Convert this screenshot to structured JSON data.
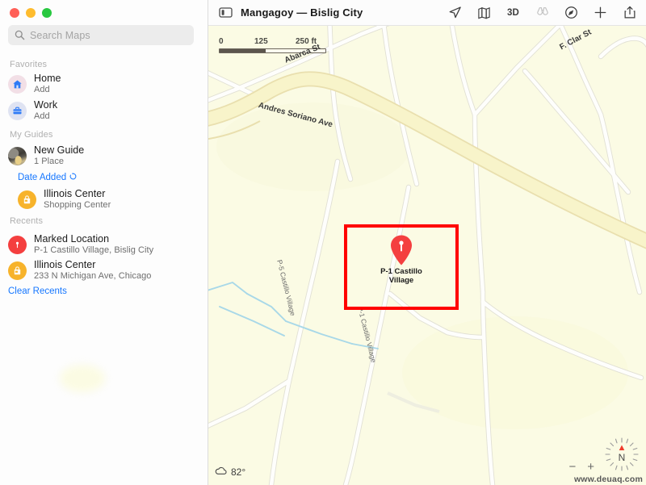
{
  "window": {
    "title": "Mangagoy — Bislig City",
    "traffic_lights": {
      "close": "close-window",
      "minimize": "minimize-window",
      "maximize": "maximize-window"
    }
  },
  "sidebar": {
    "search": {
      "placeholder": "Search Maps",
      "value": "",
      "icon": "search-icon"
    },
    "sections": [
      {
        "id": "favorites",
        "label": "Favorites"
      },
      {
        "id": "my-guides",
        "label": "My Guides"
      },
      {
        "id": "recents",
        "label": "Recents"
      }
    ],
    "favorites": [
      {
        "title": "Home",
        "sub": "Add",
        "icon": "house-icon",
        "icon_bg": "#f2dfe6"
      },
      {
        "title": "Work",
        "sub": "Add",
        "icon": "briefcase-icon",
        "icon_bg": "#dfe3f2"
      }
    ],
    "guides": [
      {
        "title": "New Guide",
        "sub": "1 Place",
        "icon": "guide-photo-thumbnail"
      }
    ],
    "sort": {
      "label": "Date Added",
      "icon": "sort-chevron-icon",
      "color": "#1677ff"
    },
    "guide_places": [
      {
        "title": "Illinois Center",
        "sub": "Shopping Center",
        "icon": "shopping-bag-icon",
        "icon_bg": "#f7b32b"
      }
    ],
    "recents": [
      {
        "title": "Marked Location",
        "sub": "P-1 Castillo Village, Bislig City",
        "icon": "map-pin-icon",
        "icon_bg": "#f43f3f"
      },
      {
        "title": "Illinois Center",
        "sub": "233 N Michigan Ave, Chicago",
        "icon": "shopping-bag-icon",
        "icon_bg": "#f7b32b"
      }
    ],
    "clear_recents": {
      "label": "Clear Recents",
      "color": "#1677ff"
    }
  },
  "toolbar": {
    "sidebar_toggle": "sidebar-toggle-icon",
    "buttons": [
      {
        "name": "location-arrow-icon",
        "label": "",
        "dim": false
      },
      {
        "name": "map-style-icon",
        "label": "",
        "dim": false
      },
      {
        "name": "three-d-toggle",
        "label": "3D",
        "dim": false
      },
      {
        "name": "binoculars-icon",
        "label": "",
        "dim": true
      },
      {
        "name": "look-around-icon",
        "label": "",
        "dim": false
      },
      {
        "name": "add-icon",
        "label": "+",
        "dim": false
      },
      {
        "name": "share-icon",
        "label": "",
        "dim": false
      }
    ]
  },
  "map": {
    "base_color": "#fbfbe4",
    "major_road_color": "#f7f3c8",
    "minor_road_color": "#fdfdfa",
    "water_color": "#a8d8e8",
    "scale": {
      "ticks": [
        "0",
        "125",
        "250 ft"
      ],
      "unit": "ft",
      "filled_fraction": "0.43"
    },
    "highlight": {
      "color": "#ff0000",
      "border_width": "4"
    },
    "pin": {
      "label_line1": "P-1 Castillo",
      "label_line2": "Village",
      "color": "#f43f3f"
    },
    "labels": [
      {
        "text": "Abarca St",
        "rotate": "22",
        "x": "95",
        "y": "38",
        "weight": "bold"
      },
      {
        "text": "Andres Soriano Ave",
        "rotate": "15",
        "x": "62",
        "y": "93",
        "weight": "bold"
      },
      {
        "text": "F. Clar St",
        "rotate": "-28",
        "x": "436",
        "y": "22",
        "weight": "bold"
      },
      {
        "text": "P-5 Castillo Village",
        "rotate": "76",
        "x": "88",
        "y": "285",
        "weight": "thin"
      },
      {
        "text": "P-1 Castillo Village",
        "rotate": "76",
        "x": "188",
        "y": "343",
        "weight": "thin"
      }
    ],
    "weather": {
      "temperature": "82°",
      "icon": "cloud-icon"
    },
    "zoom_controls": {
      "out": "−",
      "in": "+"
    },
    "compass": {
      "north_letter": "N",
      "icon": "compass-icon"
    },
    "watermark": "www.deuaq.com"
  }
}
